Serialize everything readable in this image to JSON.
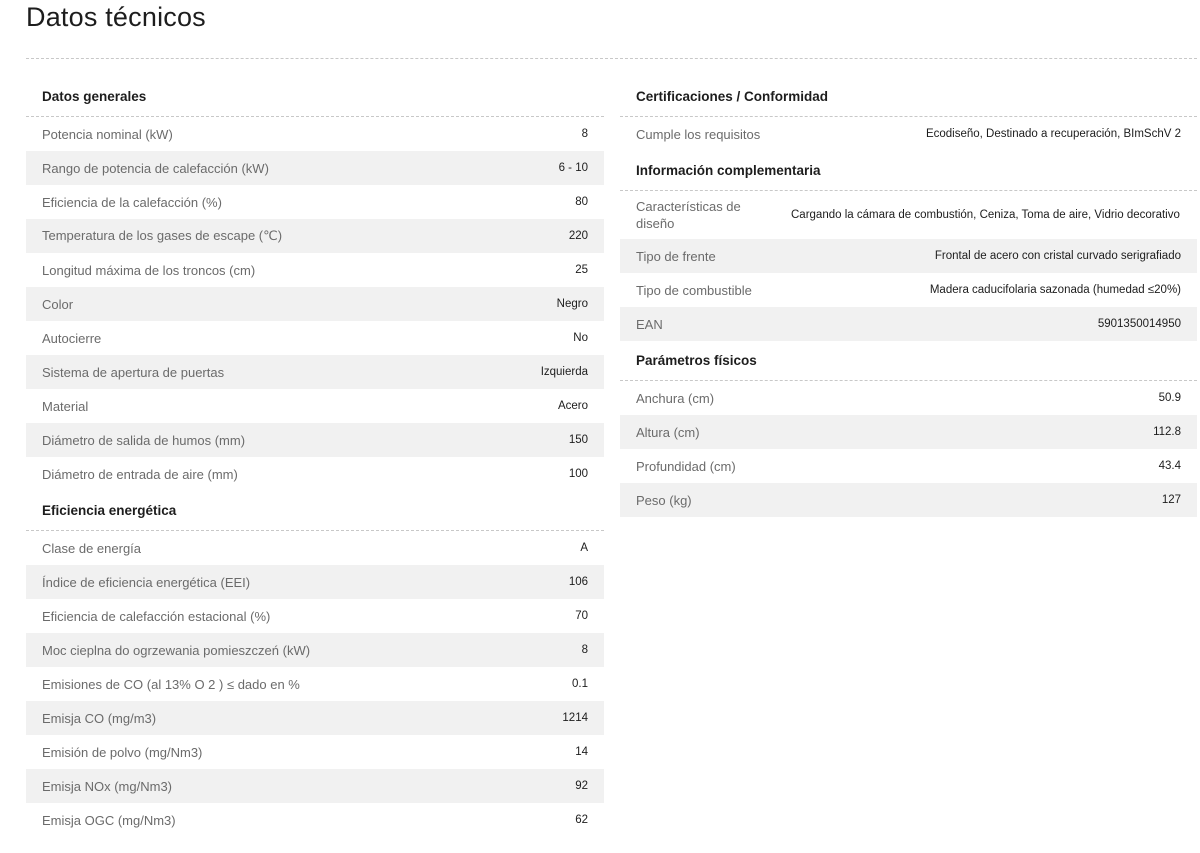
{
  "page_title": "Datos técnicos",
  "left_sections": [
    {
      "title": "Datos generales",
      "rows": [
        {
          "label": "Potencia nominal (kW)",
          "value": "8"
        },
        {
          "label": "Rango de potencia de calefacción (kW)",
          "value": "6 - 10"
        },
        {
          "label": "Eficiencia de la calefacción (%)",
          "value": "80"
        },
        {
          "label": "Temperatura de los gases de escape (℃)",
          "value": "220"
        },
        {
          "label": "Longitud máxima de los troncos (cm)",
          "value": "25"
        },
        {
          "label": "Color",
          "value": "Negro"
        },
        {
          "label": "Autocierre",
          "value": "No"
        },
        {
          "label": "Sistema de apertura de puertas",
          "value": "Izquierda"
        },
        {
          "label": "Material",
          "value": "Acero"
        },
        {
          "label": "Diámetro de salida de humos (mm)",
          "value": "150"
        },
        {
          "label": "Diámetro de entrada de aire (mm)",
          "value": "100"
        }
      ]
    },
    {
      "title": "Eficiencia energética",
      "rows": [
        {
          "label": "Clase de energía",
          "value": "A"
        },
        {
          "label": "Índice de eficiencia energética (EEI)",
          "value": "106"
        },
        {
          "label": "Eficiencia de calefacción estacional (%)",
          "value": "70"
        },
        {
          "label": "Moc cieplna do ogrzewania pomieszczeń (kW)",
          "value": "8"
        },
        {
          "label": "Emisiones de CO (al 13% O 2 ) ≤ dado en %",
          "value": "0.1"
        },
        {
          "label": "Emisja CO (mg/m3)",
          "value": "1214"
        },
        {
          "label": "Emisión de polvo (mg/Nm3)",
          "value": "14"
        },
        {
          "label": "Emisja NOx (mg/Nm3)",
          "value": "92"
        },
        {
          "label": "Emisja OGC (mg/Nm3)",
          "value": "62"
        }
      ]
    }
  ],
  "right_sections": [
    {
      "title": "Certificaciones / Conformidad",
      "rows": [
        {
          "label": "Cumple los requisitos",
          "value": "Ecodiseño, Destinado a recuperación, BImSchV 2"
        }
      ]
    },
    {
      "title": "Información complementaria",
      "rows": [
        {
          "label": "Características de diseño",
          "value": "Cargando la cámara de combustión, Ceniza, Toma de aire, Vidrio decorativo"
        },
        {
          "label": "Tipo de frente",
          "value": "Frontal de acero con cristal curvado serigrafiado"
        },
        {
          "label": "Tipo de combustible",
          "value": "Madera caducifolaria sazonada (humedad ≤20%)"
        },
        {
          "label": "EAN",
          "value": "5901350014950"
        }
      ]
    },
    {
      "title": "Parámetros físicos",
      "rows": [
        {
          "label": "Anchura (cm)",
          "value": "50.9"
        },
        {
          "label": "Altura (cm)",
          "value": "112.8"
        },
        {
          "label": "Profundidad (cm)",
          "value": "43.4"
        },
        {
          "label": "Peso (kg)",
          "value": "127"
        }
      ]
    }
  ]
}
